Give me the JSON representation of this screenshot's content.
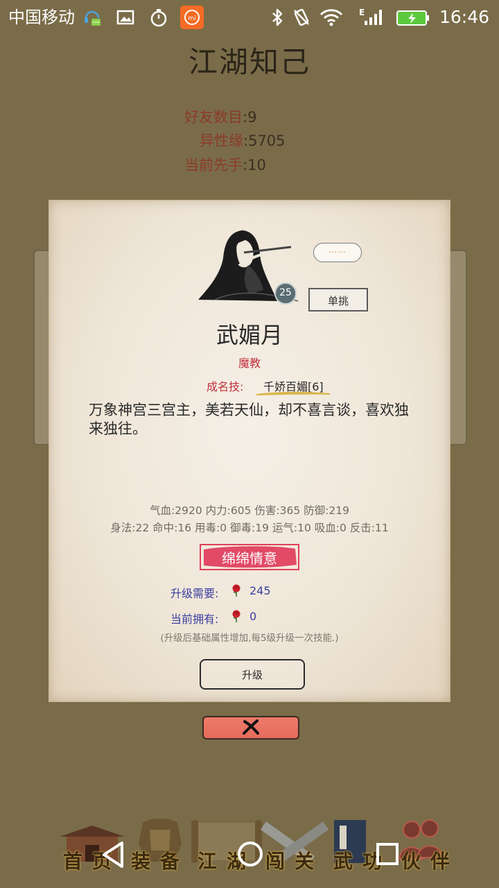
{
  "status_bar": {
    "carrier": "中国移动",
    "time": "16:46",
    "network_letter": "E"
  },
  "page": {
    "title": "江湖知己",
    "stats": [
      {
        "label": "好友数目",
        "value": "9"
      },
      {
        "label": "异性缘",
        "value": "5705"
      },
      {
        "label": "当前先手",
        "value": "10"
      }
    ]
  },
  "dialog": {
    "bubble_text": "……",
    "level": "25",
    "duel_button": "单挑",
    "name": "武媚月",
    "faction": "魔教",
    "fame_label": "成名技:",
    "fame_skill": "千娇百媚[6]",
    "description": "万象神宫三宫主，美若天仙，却不喜言谈，喜欢独来独往。",
    "attributes_line1": "气血:2920  内力:605  伤害:365  防御:219",
    "attributes_line2": "身法:22  命中:16  用毒:0  御毒:19  运气:10  吸血:0  反击:11",
    "affection_title": "绵绵情意",
    "upgrade_need_label": "升级需要:",
    "upgrade_need_value": "245",
    "current_own_label": "当前拥有:",
    "current_own_value": "0",
    "note": "(升级后基础属性增加,每5级升级一次技能.)",
    "upgrade_button": "升级"
  },
  "bottom_nav": {
    "items": [
      {
        "label": "首页",
        "icon": "house-icon"
      },
      {
        "label": "装备",
        "icon": "armor-icon"
      },
      {
        "label": "江湖",
        "icon": "scroll-map-icon"
      },
      {
        "label": "闯关",
        "icon": "crossed-swords-icon"
      },
      {
        "label": "武功",
        "icon": "book-icon"
      },
      {
        "label": "伙伴",
        "icon": "companions-icon"
      }
    ]
  },
  "colors": {
    "background": "#7a6c49",
    "stat_label": "#8a3a2c",
    "accent_red": "#c0303c",
    "link_blue": "#3a3fa0",
    "close_button": "#e8705f"
  }
}
